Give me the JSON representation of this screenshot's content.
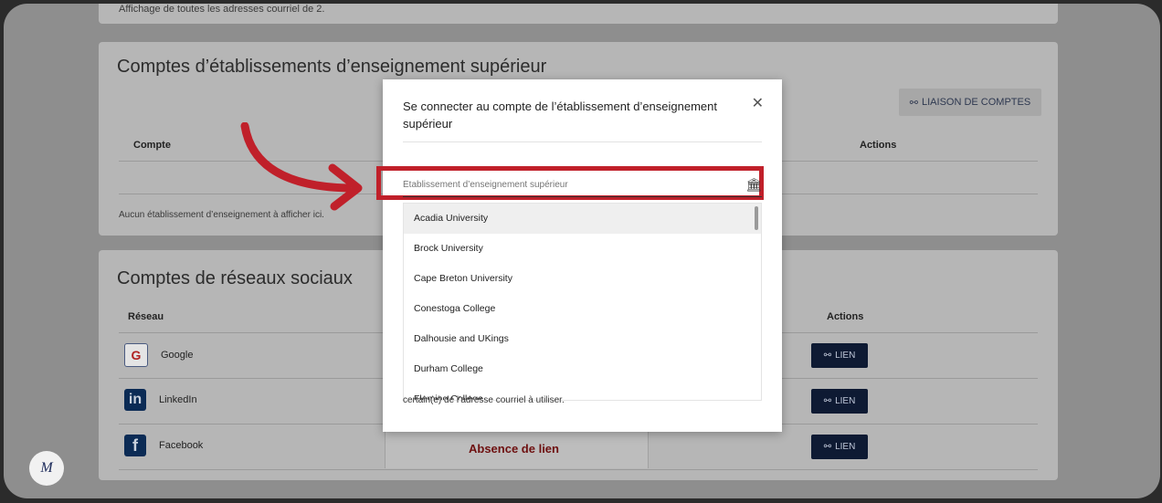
{
  "top_note": "Affichage de toutes les adresses courriel de 2.",
  "institutions": {
    "title": "Comptes d’établissements d’enseignement supérieur",
    "link_button": "LIAISON DE COMPTES",
    "col_account": "Compte",
    "col_actions": "Actions",
    "empty_text": "Aucun établissement d’enseignement à afficher ici."
  },
  "social": {
    "title": "Comptes de réseaux sociaux",
    "col_network": "Réseau",
    "col_actions": "Actions",
    "rows": [
      {
        "name": "Google",
        "icon": "google-icon",
        "action": "LIEN"
      },
      {
        "name": "LinkedIn",
        "icon": "linkedin-icon",
        "action": "LIEN"
      },
      {
        "name": "Facebook",
        "icon": "facebook-icon",
        "action": "LIEN",
        "status": "Absence de lien"
      }
    ]
  },
  "modal": {
    "title": "Se connecter au compte de l’établissement d’enseignement supérieur",
    "search_placeholder": "Établissement d’enseignement supérieur",
    "options": [
      "Acadia University",
      "Brock University",
      "Cape Breton University",
      "Conestoga College",
      "Dalhousie and UKings",
      "Durham College",
      "Fleming College"
    ],
    "note": "certain(e) de l’adresse courriel à utiliser."
  },
  "colors": {
    "highlight": "#c0202a",
    "dark_button": "#0e1a33",
    "absence_text": "#6e1010"
  }
}
